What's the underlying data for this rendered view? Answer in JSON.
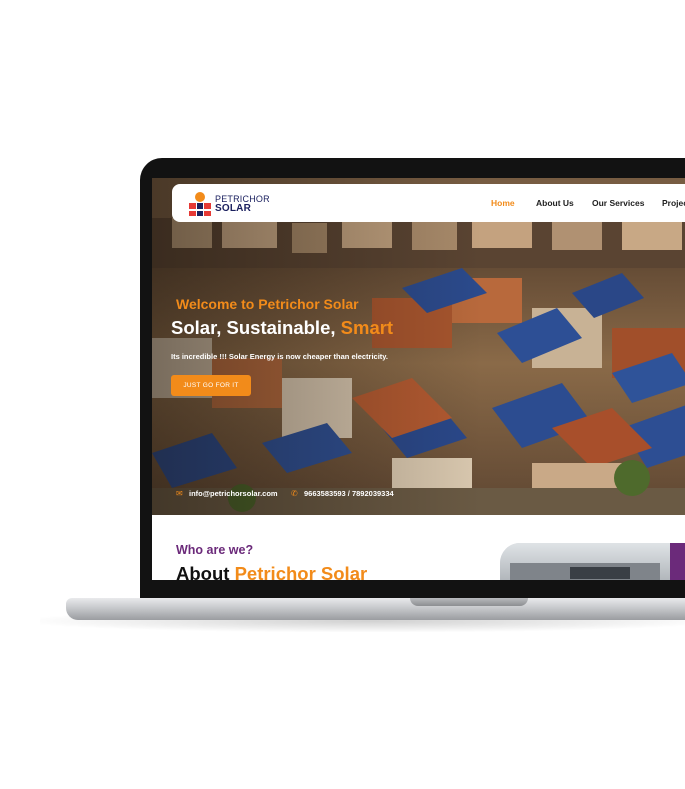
{
  "brand": {
    "name_line1": "PETRICHOR",
    "name_line2": "SOLAR",
    "colors": {
      "orange": "#f28b1a",
      "purple": "#6b2a7a",
      "navy": "#1a1f5e",
      "red": "#e53935"
    }
  },
  "nav": {
    "items": [
      {
        "label": "Home",
        "active": true
      },
      {
        "label": "About Us",
        "active": false
      },
      {
        "label": "Our Services",
        "active": false
      },
      {
        "label": "Projec",
        "active": false
      }
    ]
  },
  "hero": {
    "welcome": "Welcome to Petrichor Solar",
    "headline_main": "Solar, Sustainable, ",
    "headline_accent": "Smart",
    "tagline": "Its incredible !!! Solar Energy is now cheaper than electricity.",
    "cta_label": "JUST GO FOR IT",
    "email": "info@petrichorsolar.com",
    "phone": "9663583593 / 7892039334",
    "icons": {
      "email": "envelope-icon",
      "phone": "phone-icon"
    }
  },
  "about": {
    "kicker": "Who are we?",
    "title_main": "About ",
    "title_accent": "Petrichor Solar"
  }
}
